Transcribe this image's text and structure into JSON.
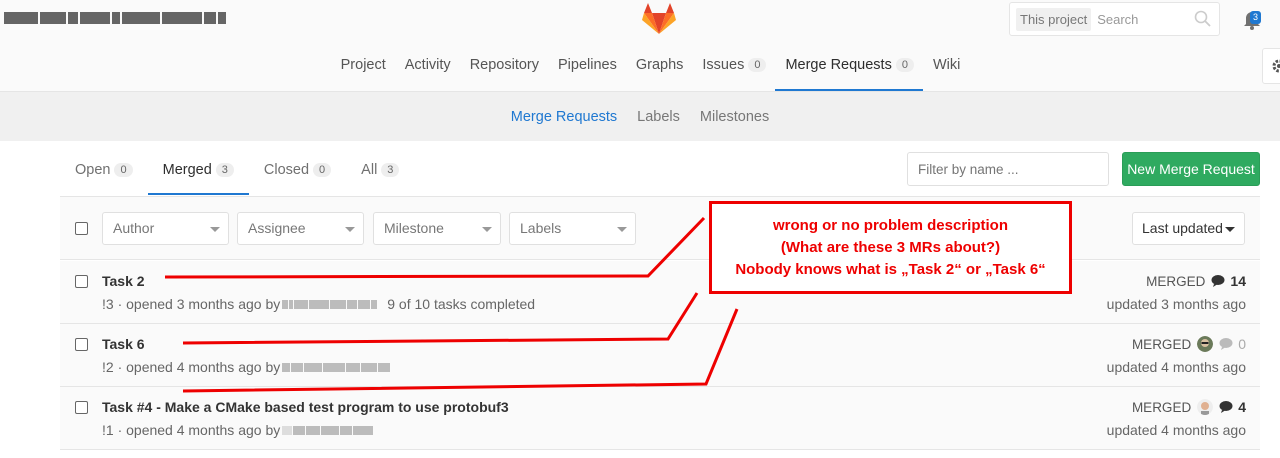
{
  "header": {
    "search_scope": "This project",
    "search_placeholder": "Search",
    "notification_count": "3"
  },
  "nav": {
    "items": [
      {
        "label": "Project"
      },
      {
        "label": "Activity"
      },
      {
        "label": "Repository"
      },
      {
        "label": "Pipelines"
      },
      {
        "label": "Graphs"
      },
      {
        "label": "Issues",
        "count": "0"
      },
      {
        "label": "Merge Requests",
        "count": "0"
      },
      {
        "label": "Wiki"
      }
    ]
  },
  "subnav": {
    "items": [
      "Merge Requests",
      "Labels",
      "Milestones"
    ]
  },
  "tabs": [
    {
      "label": "Open",
      "count": "0"
    },
    {
      "label": "Merged",
      "count": "3"
    },
    {
      "label": "Closed",
      "count": "0"
    },
    {
      "label": "All",
      "count": "3"
    }
  ],
  "filter": {
    "placeholder": "Filter by name ...",
    "new_button": "New Merge Request",
    "dropdowns": [
      "Author",
      "Assignee",
      "Milestone",
      "Labels"
    ],
    "sort": "Last updated"
  },
  "merge_requests": [
    {
      "title": "Task 2",
      "meta": "!3 · opened 3 months ago by",
      "tasks": "9 of 10 tasks completed",
      "status": "MERGED",
      "comments": "14",
      "updated": "updated 3 months ago"
    },
    {
      "title": "Task 6",
      "meta": "!2 · opened 4 months ago by",
      "status": "MERGED",
      "comments": "0",
      "updated": "updated 4 months ago"
    },
    {
      "title": "Task #4 - Make a CMake based test program to use protobuf3",
      "meta": "!1 · opened 4 months ago by",
      "status": "MERGED",
      "comments": "4",
      "updated": "updated 4 months ago"
    }
  ],
  "annotation": {
    "line1": "wrong or no problem description",
    "line2": "(What are these 3 MRs about?)",
    "line3": "Nobody knows what is „Task 2“ or „Task 6“",
    "color": "#ee0000"
  },
  "colors": {
    "accent": "#1f78d1",
    "success": "#2faa60"
  }
}
